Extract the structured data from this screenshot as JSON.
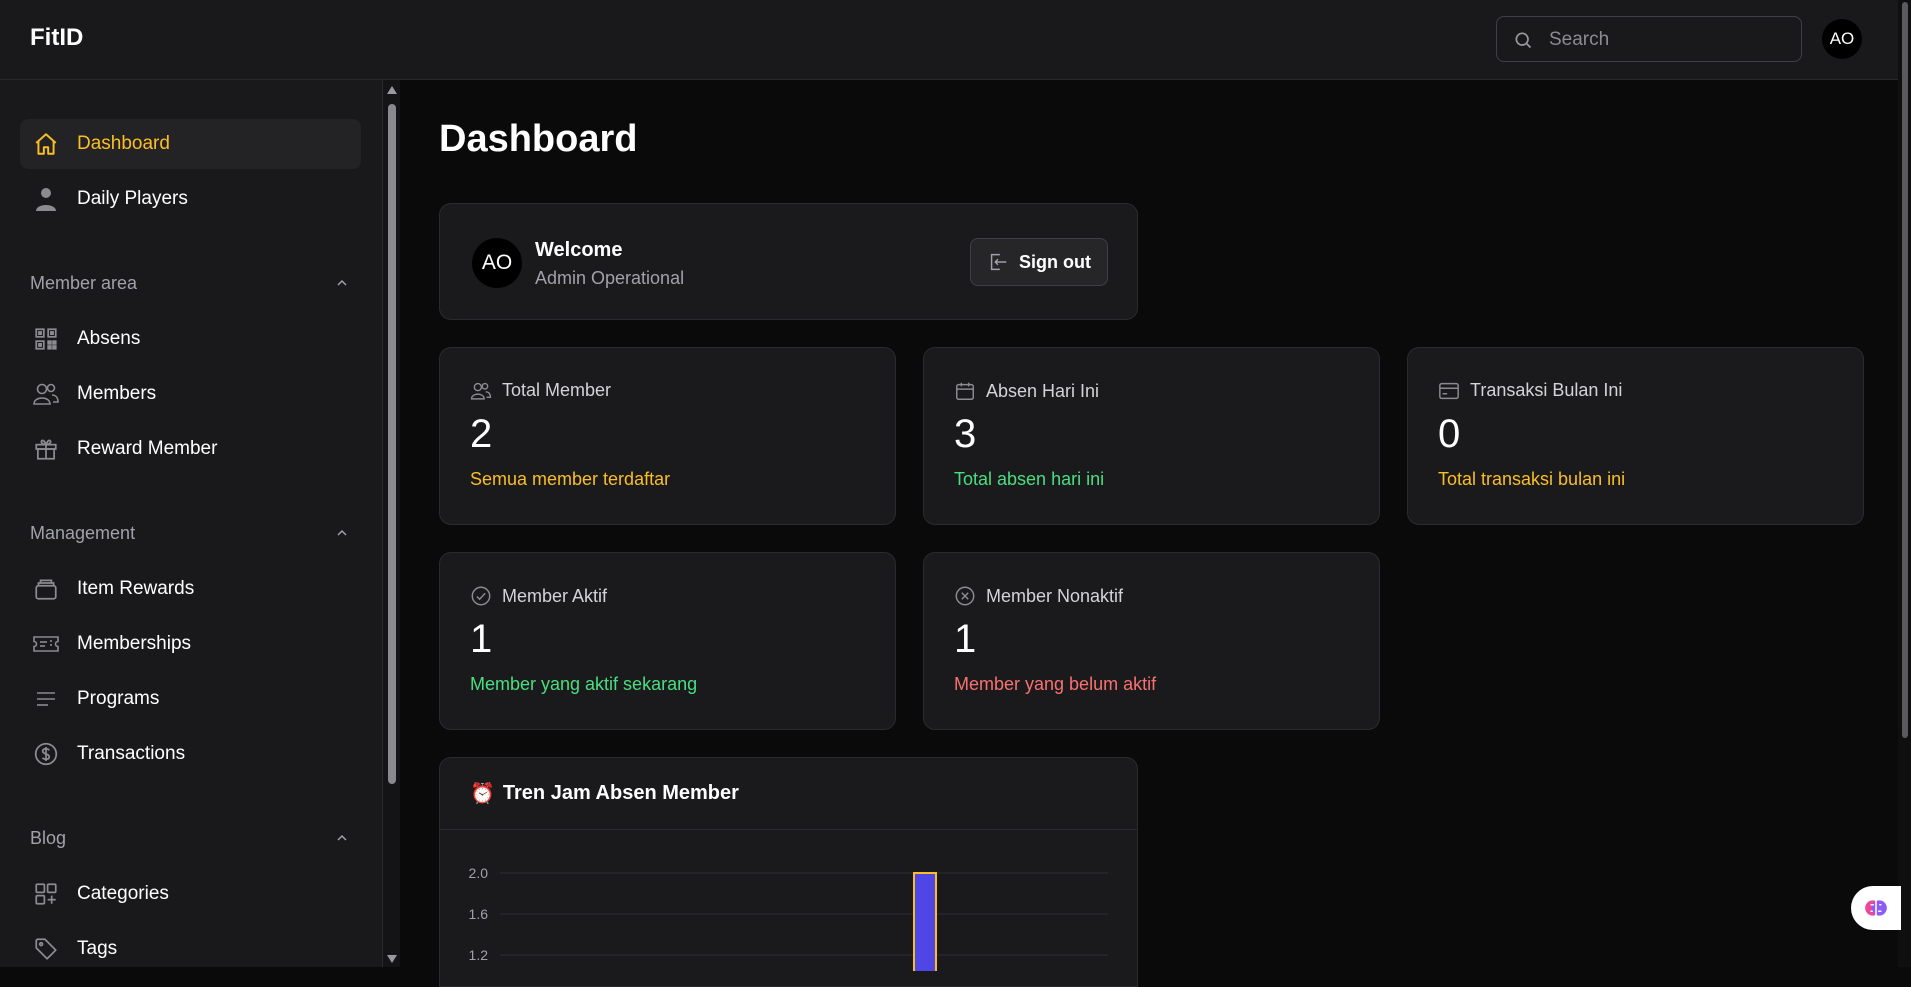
{
  "app": {
    "brand": "FitID"
  },
  "header": {
    "search": {
      "placeholder": "Search",
      "value": ""
    },
    "avatar_initials": "AO"
  },
  "sidebar": {
    "top_items": [
      {
        "label": "Dashboard",
        "icon": "home-icon",
        "active": true
      },
      {
        "label": "Daily Players",
        "icon": "user-icon",
        "active": false
      }
    ],
    "groups": [
      {
        "label": "Member area",
        "items": [
          {
            "label": "Absens",
            "icon": "qr-code-icon"
          },
          {
            "label": "Members",
            "icon": "users-icon"
          },
          {
            "label": "Reward Member",
            "icon": "gift-icon"
          }
        ]
      },
      {
        "label": "Management",
        "items": [
          {
            "label": "Item Rewards",
            "icon": "stack-icon"
          },
          {
            "label": "Memberships",
            "icon": "ticket-icon"
          },
          {
            "label": "Programs",
            "icon": "lines-icon"
          },
          {
            "label": "Transactions",
            "icon": "dollar-circle-icon"
          }
        ]
      },
      {
        "label": "Blog",
        "items": [
          {
            "label": "Categories",
            "icon": "squares-plus-icon"
          },
          {
            "label": "Tags",
            "icon": "tag-icon"
          }
        ]
      }
    ]
  },
  "main": {
    "title": "Dashboard",
    "welcome": {
      "avatar_initials": "AO",
      "title": "Welcome",
      "subtitle": "Admin Operational",
      "signout_label": "Sign out"
    },
    "stats": [
      {
        "label": "Total Member",
        "icon": "users-icon",
        "value": "2",
        "subtitle": "Semua member terdaftar",
        "color": "#fbbf24"
      },
      {
        "label": "Absen Hari Ini",
        "icon": "calendar-icon",
        "value": "3",
        "subtitle": "Total absen hari ini",
        "color": "#4ade80"
      },
      {
        "label": "Transaksi Bulan Ini",
        "icon": "credit-card-icon",
        "value": "0",
        "subtitle": "Total transaksi bulan ini",
        "color": "#fbbf24"
      },
      {
        "label": "Member Aktif",
        "icon": "check-circle-icon",
        "value": "1",
        "subtitle": "Member yang aktif sekarang",
        "color": "#4ade80"
      },
      {
        "label": "Member Nonaktif",
        "icon": "x-circle-icon",
        "value": "1",
        "subtitle": "Member yang belum aktif",
        "color": "#f87171"
      }
    ],
    "chart_card": {
      "title": "Tren Jam Absen Member",
      "emoji": "⏰"
    }
  },
  "chart_data": {
    "type": "bar",
    "title": "Tren Jam Absen Member",
    "y_ticks_visible": [
      "2.0",
      "1.6",
      "1.2"
    ],
    "ylim": [
      0,
      2.0
    ],
    "grid": true,
    "visible_bar_values": [
      2
    ],
    "bar_color": "#4f46e5",
    "bar_border_color": "#fbbf24"
  },
  "colors": {
    "accent": "#fbbf24",
    "success": "#4ade80",
    "danger": "#f87171",
    "bar_fill": "#4f46e5"
  }
}
